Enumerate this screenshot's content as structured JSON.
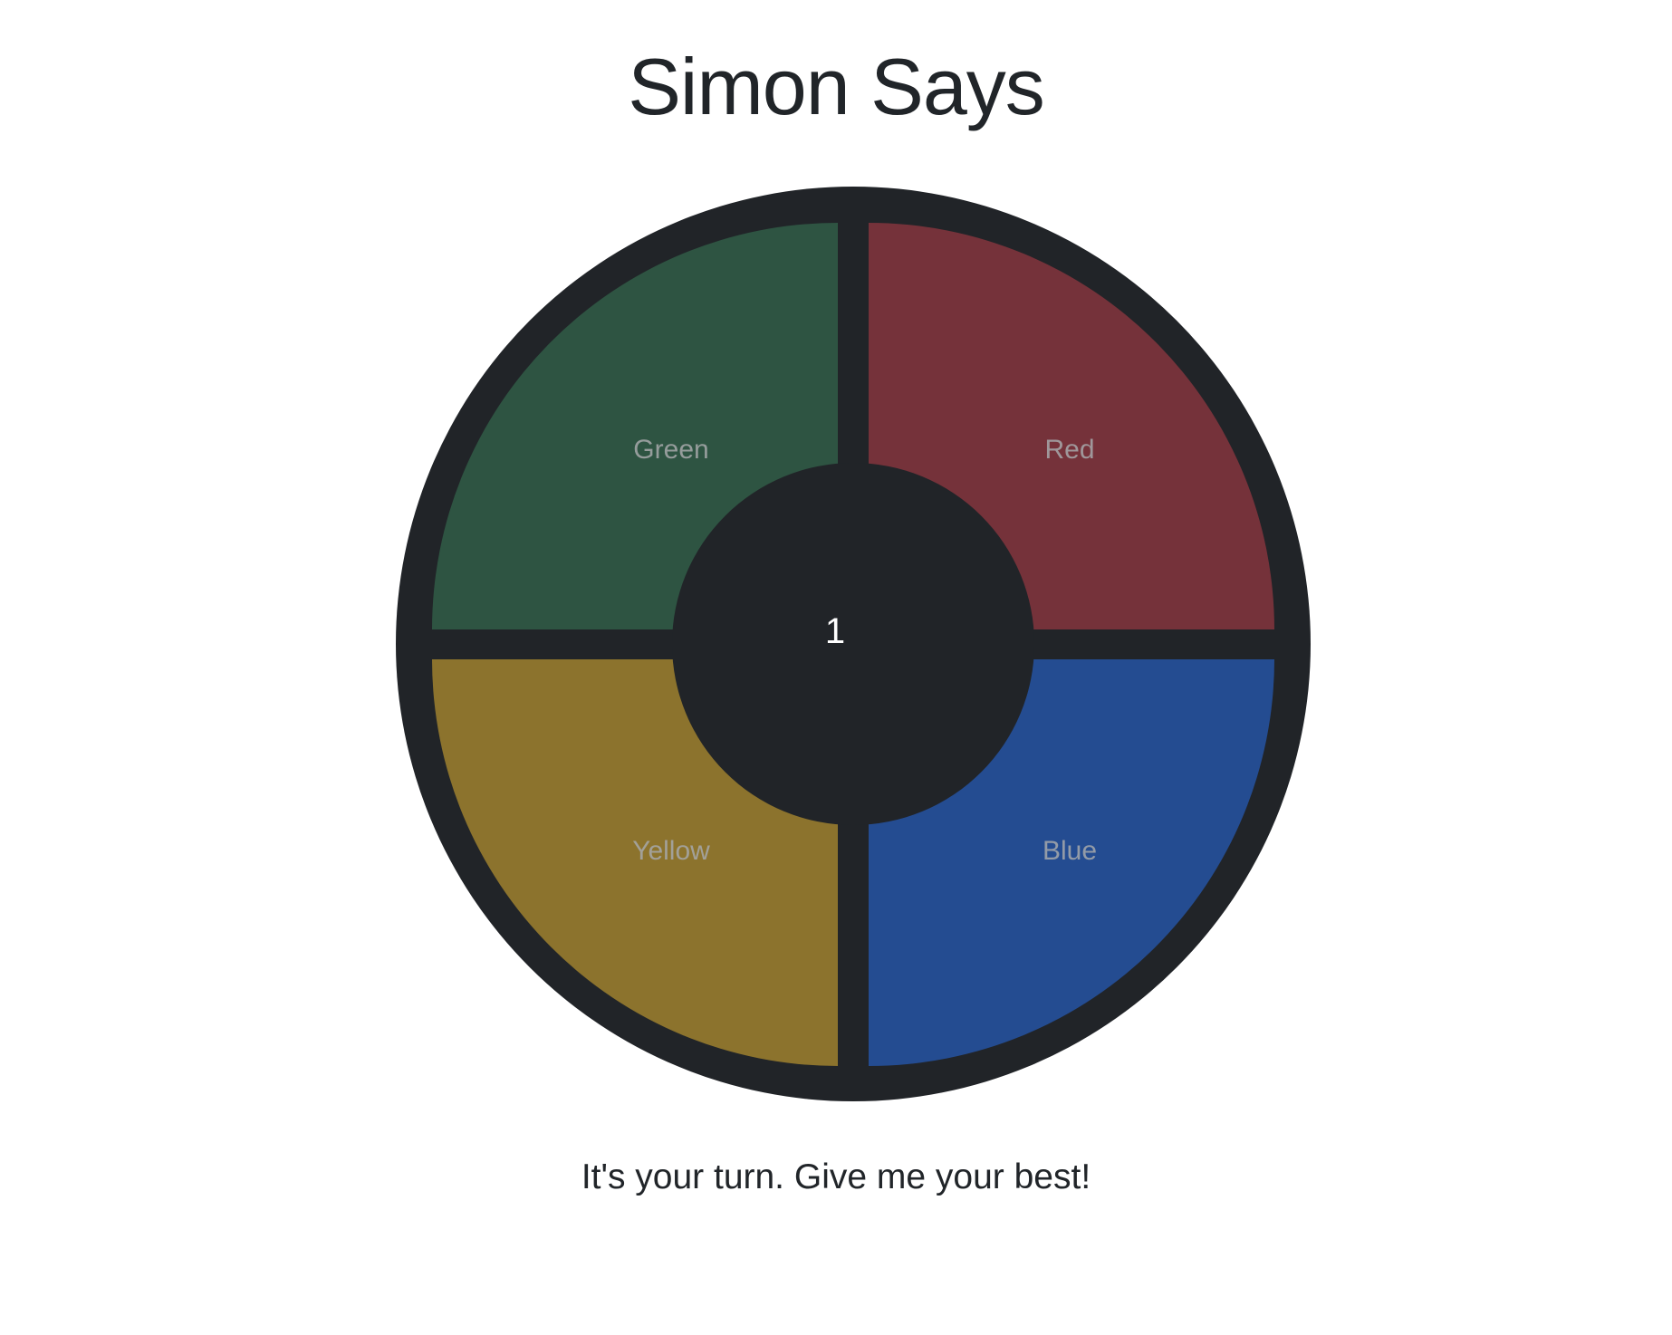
{
  "title": "Simon Says",
  "pads": {
    "green": {
      "label": "Green",
      "color": "#2e5442"
    },
    "red": {
      "label": "Red",
      "color": "#75323a"
    },
    "yellow": {
      "label": "Yellow",
      "color": "#8c732d"
    },
    "blue": {
      "label": "Blue",
      "color": "#244c91"
    }
  },
  "round": "1",
  "status": "It's your turn. Give me your best!",
  "colors": {
    "board": "#212428",
    "text": "#212529"
  }
}
